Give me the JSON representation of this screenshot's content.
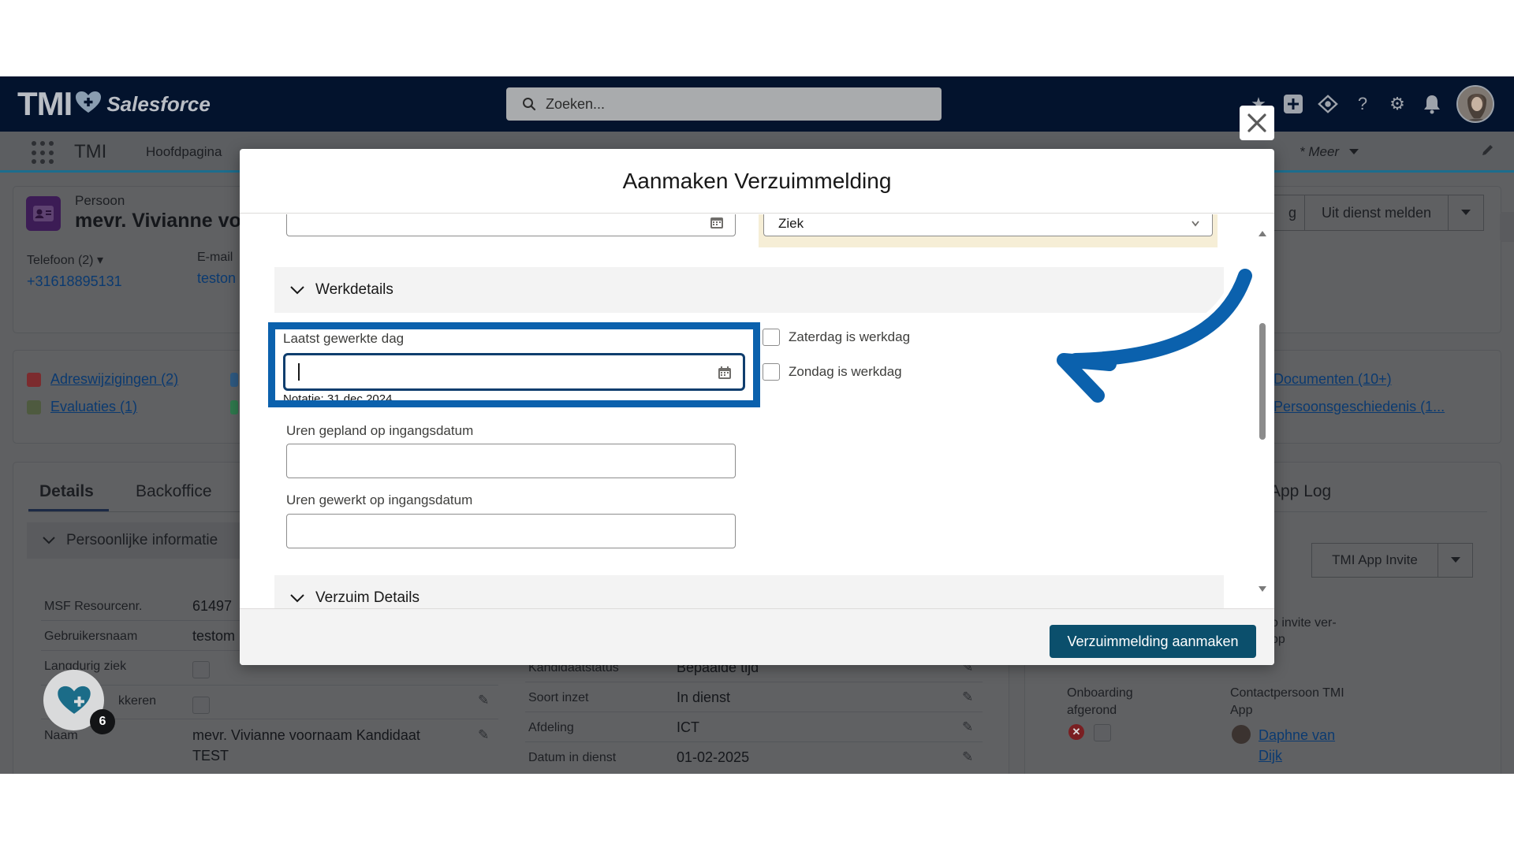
{
  "header": {
    "logo_tmi": "TMI",
    "logo_salesforce": "Salesforce",
    "search_placeholder": "Zoeken..."
  },
  "nav": {
    "app_name": "TMI",
    "home": "Hoofdpagina",
    "more": "* Meer"
  },
  "record": {
    "type": "Persoon",
    "name": "mevr. Vivianne vo",
    "phone_label": "Telefoon (2)",
    "phone_value": "+31618895131",
    "email_label": "E-mail",
    "email_value": "teston",
    "buttons": {
      "partial": "g",
      "uit_dienst": "Uit dienst melden"
    }
  },
  "related": {
    "adreswijzigingen": "Adreswijzigingen (2)",
    "evaluaties": "Evaluaties (1)",
    "documenten": "Documenten (10+)",
    "persoonsgeschiedenis": "Persoonsgeschiedenis (1..."
  },
  "details": {
    "tabs": [
      "Details",
      "Backoffice"
    ],
    "section": "Persoonlijke informatie",
    "fields": [
      {
        "label": "MSF Resourcenr.",
        "value": "61497"
      },
      {
        "label": "Gebruikersnaam",
        "value": "testom"
      },
      {
        "label": "Langdurig ziek",
        "value": ""
      },
      {
        "label": "kkeren",
        "value": ""
      },
      {
        "label": "Naam",
        "value": "mevr. Vivianne voornaam Kandidaat",
        "value2": "TEST"
      }
    ],
    "mid_fields": [
      {
        "label": "Kandidaatstatus",
        "value": "Bepaalde tijd"
      },
      {
        "label": "Soort inzet",
        "value": "In dienst"
      },
      {
        "label": "Afdeling",
        "value": "ICT"
      },
      {
        "label": "Datum in dienst",
        "value": "01-02-2025"
      }
    ]
  },
  "right_panel": {
    "title": "App Log",
    "invite_button": "TMI App Invite",
    "note_line1": "o invite ver-",
    "note_line2": "op",
    "onboarding_label1": "Onboarding",
    "onboarding_label2": "afgerond",
    "contact_label1": "Contactpersoon TMI",
    "contact_label2": "App",
    "contact_name1": "Daphne van",
    "contact_name2": "Dijk"
  },
  "fab": {
    "badge": "6"
  },
  "modal": {
    "title": "Aanmaken Verzuimmelding",
    "top_select_value": "Ziek",
    "section_werkdetails": "Werkdetails",
    "laatst_label": "Laatst gewerkte dag",
    "laatst_value": "",
    "laatst_hint": "Notatie: 31 dec 2024",
    "zaterdag_label": "Zaterdag is werkdag",
    "zondag_label": "Zondag is werkdag",
    "uren_gepland_label": "Uren gepland op ingangsdatum",
    "uren_gewerkt_label": "Uren gewerkt op ingangsdatum",
    "section_verzuim": "Verzuim Details",
    "submit": "Verzuimmelding aanmaken"
  },
  "colors": {
    "highlight": "#0b61ad",
    "primary": "#0b4f6c",
    "header_bg": "#03132d"
  }
}
